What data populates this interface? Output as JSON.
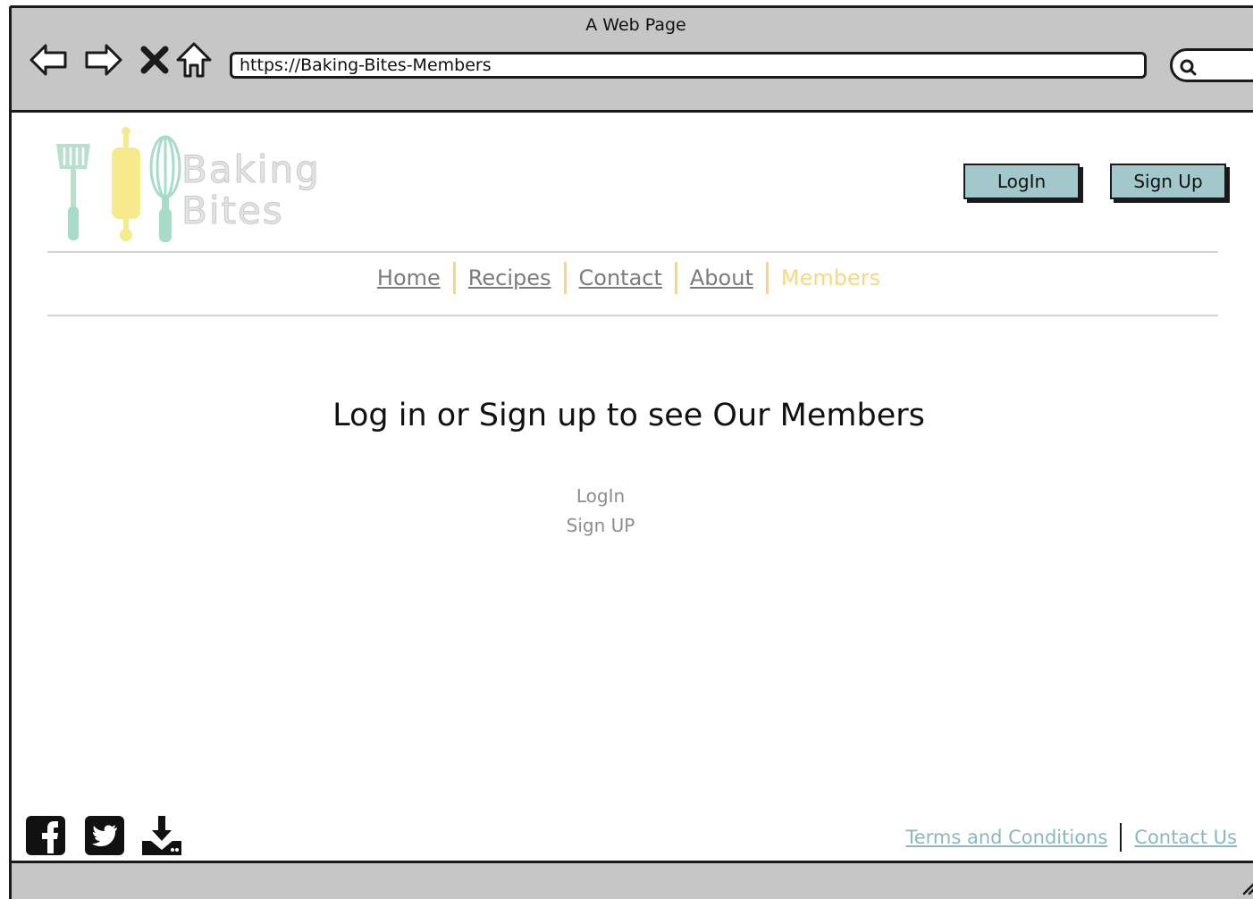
{
  "browser": {
    "window_title": "A Web Page",
    "url": "https://Baking-Bites-Members"
  },
  "logo": {
    "line1": "Baking",
    "line2": "Bites",
    "colors": {
      "spatula": "#b8e0cf",
      "rolling_pin": "#f5ea8c",
      "whisk": "#a7dcc8"
    }
  },
  "header": {
    "login_label": "LogIn",
    "signup_label": "Sign Up"
  },
  "nav": {
    "items": [
      {
        "label": "Home"
      },
      {
        "label": "Recipes"
      },
      {
        "label": "Contact"
      },
      {
        "label": "About"
      },
      {
        "label": "Members"
      }
    ],
    "active": "Members",
    "accent_color": "#f7d77f"
  },
  "main": {
    "heading": "Log in or Sign up to see Our Members",
    "login_link": "LogIn",
    "signup_link": "Sign UP"
  },
  "footer": {
    "social_icons": [
      "facebook-icon",
      "twitter-icon",
      "download-icon"
    ],
    "terms_label": "Terms and Conditions",
    "contact_label": "Contact Us",
    "link_color": "#8ab8c0"
  },
  "colors": {
    "button_bg": "#a2c8cc",
    "chrome_bg": "#c6c6c6"
  }
}
